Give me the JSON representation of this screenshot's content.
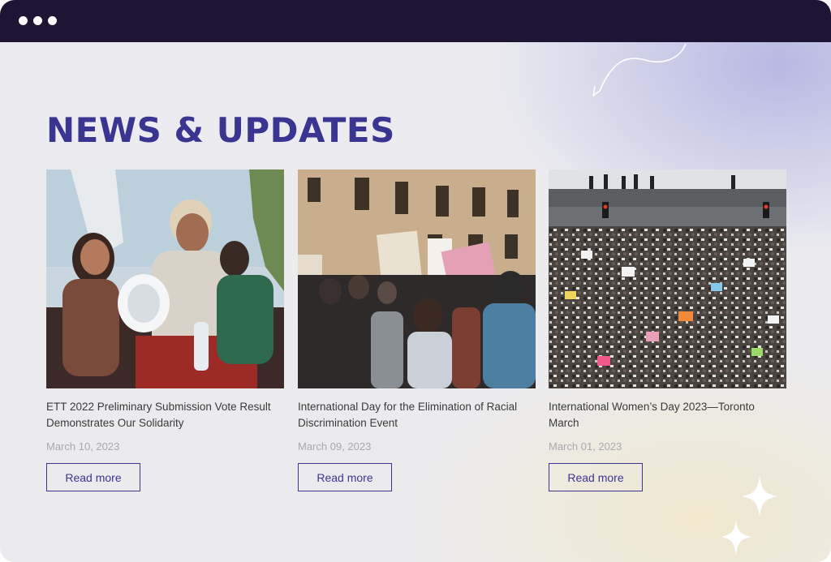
{
  "window": {
    "controls": [
      "close",
      "minimize",
      "maximize"
    ]
  },
  "section": {
    "heading": "NEWS & UPDATES"
  },
  "colors": {
    "accent": "#3b3592",
    "titlebar": "#1e1433",
    "date": "#a9a9ad"
  },
  "cards": [
    {
      "image": "protest-megaphone-photo",
      "title": "ETT 2022 Preliminary Submission Vote Result Demonstrates Our Solidarity",
      "date": "March 10, 2023",
      "button": "Read more"
    },
    {
      "image": "street-protest-signs-photo",
      "title": "International Day for the Elimination of Racial Discrimination Event",
      "date": "March 09, 2023",
      "button": "Read more"
    },
    {
      "image": "crowd-march-overpass-photo",
      "title": "International Women’s Day 2023—Toronto March",
      "date": "March 01, 2023",
      "button": "Read more"
    }
  ],
  "decorations": [
    "curved-arrow-icon",
    "sparkle-icon"
  ]
}
